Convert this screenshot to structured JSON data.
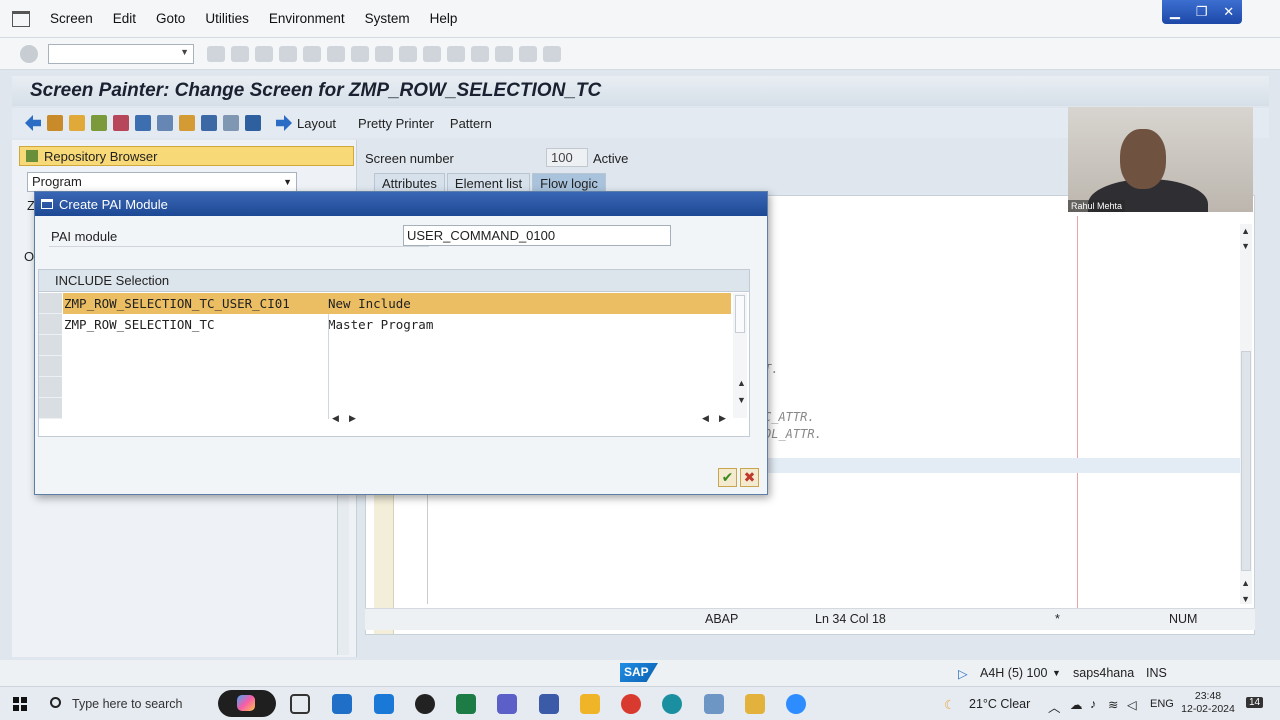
{
  "menubar": {
    "items": [
      "Screen",
      "Edit",
      "Goto",
      "Utilities",
      "Environment",
      "System",
      "Help"
    ]
  },
  "window_controls": {
    "minimize": "▁",
    "restore": "❐",
    "close": "✕"
  },
  "title": "Screen Painter: Change Screen for ZMP_ROW_SELECTION_TC",
  "app_toolbar": {
    "layout_label": "Layout",
    "pretty_printer_label": "Pretty Printer",
    "pattern_label": "Pattern"
  },
  "left_pane": {
    "repository_browser_label": "Repository Browser",
    "object_type_value": "Program",
    "partial_z": "Z",
    "partial_o": "O"
  },
  "screen": {
    "number_label": "Screen number",
    "number_value": "100",
    "status": "Active"
  },
  "tabs": [
    "Attributes",
    "Element list",
    "Flow logic"
  ],
  "active_tab": "Flow logic",
  "editor": {
    "code_fragments": [
      "T.",
      "C_ATTR.",
      "OL_ATTR."
    ],
    "status": {
      "language": "ABAP",
      "position": "Ln  34 Col  18",
      "modified_marker": "*",
      "num": "NUM"
    }
  },
  "webcam": {
    "name": "Rahul Mehta"
  },
  "dialog": {
    "title": "Create PAI Module",
    "pai_module_label": "PAI module",
    "pai_module_value": "USER_COMMAND_0100",
    "include_section_label": "INCLUDE Selection",
    "rows": [
      {
        "include": "ZMP_ROW_SELECTION_TC_USER_CI01",
        "description": "New Include",
        "selected": true
      },
      {
        "include": "ZMP_ROW_SELECTION_TC",
        "description": "Master Program",
        "selected": false
      }
    ],
    "ok_symbol": "✔",
    "cancel_symbol": "✖"
  },
  "sap_status": {
    "logo_text": "SAP",
    "system": "A4H (5) 100",
    "server": "saps4hana",
    "mode": "INS"
  },
  "taskbar": {
    "search_placeholder": "Type here to search",
    "weather": "21°C  Clear",
    "language": "ENG",
    "time": "23:48",
    "date": "12-02-2024",
    "notification_count": "14"
  },
  "colors": {
    "dialog_title": "#1d4894",
    "selected_row": "#ebbe64",
    "repository_button": "#f8d977",
    "active_tab": "#a9c3dd"
  }
}
